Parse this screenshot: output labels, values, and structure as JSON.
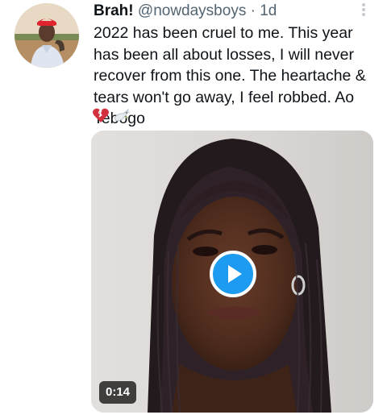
{
  "tweet": {
    "display_name": "Brah!",
    "handle": "@nowdaysboys",
    "separator": "·",
    "time": "1d",
    "text": "2022 has been cruel to me. This year has been all about losses, I will never recover from this one. The heartache & tears won't go away, I feel robbed. Ao Tebogo",
    "emojis": [
      "broken-heart-icon",
      "dove-icon"
    ]
  },
  "media": {
    "type": "video",
    "duration": "0:14"
  },
  "colors": {
    "accent": "#1d9bf0",
    "text": "#0f1419",
    "secondary": "#536471",
    "broken_heart": "#d3303f"
  }
}
